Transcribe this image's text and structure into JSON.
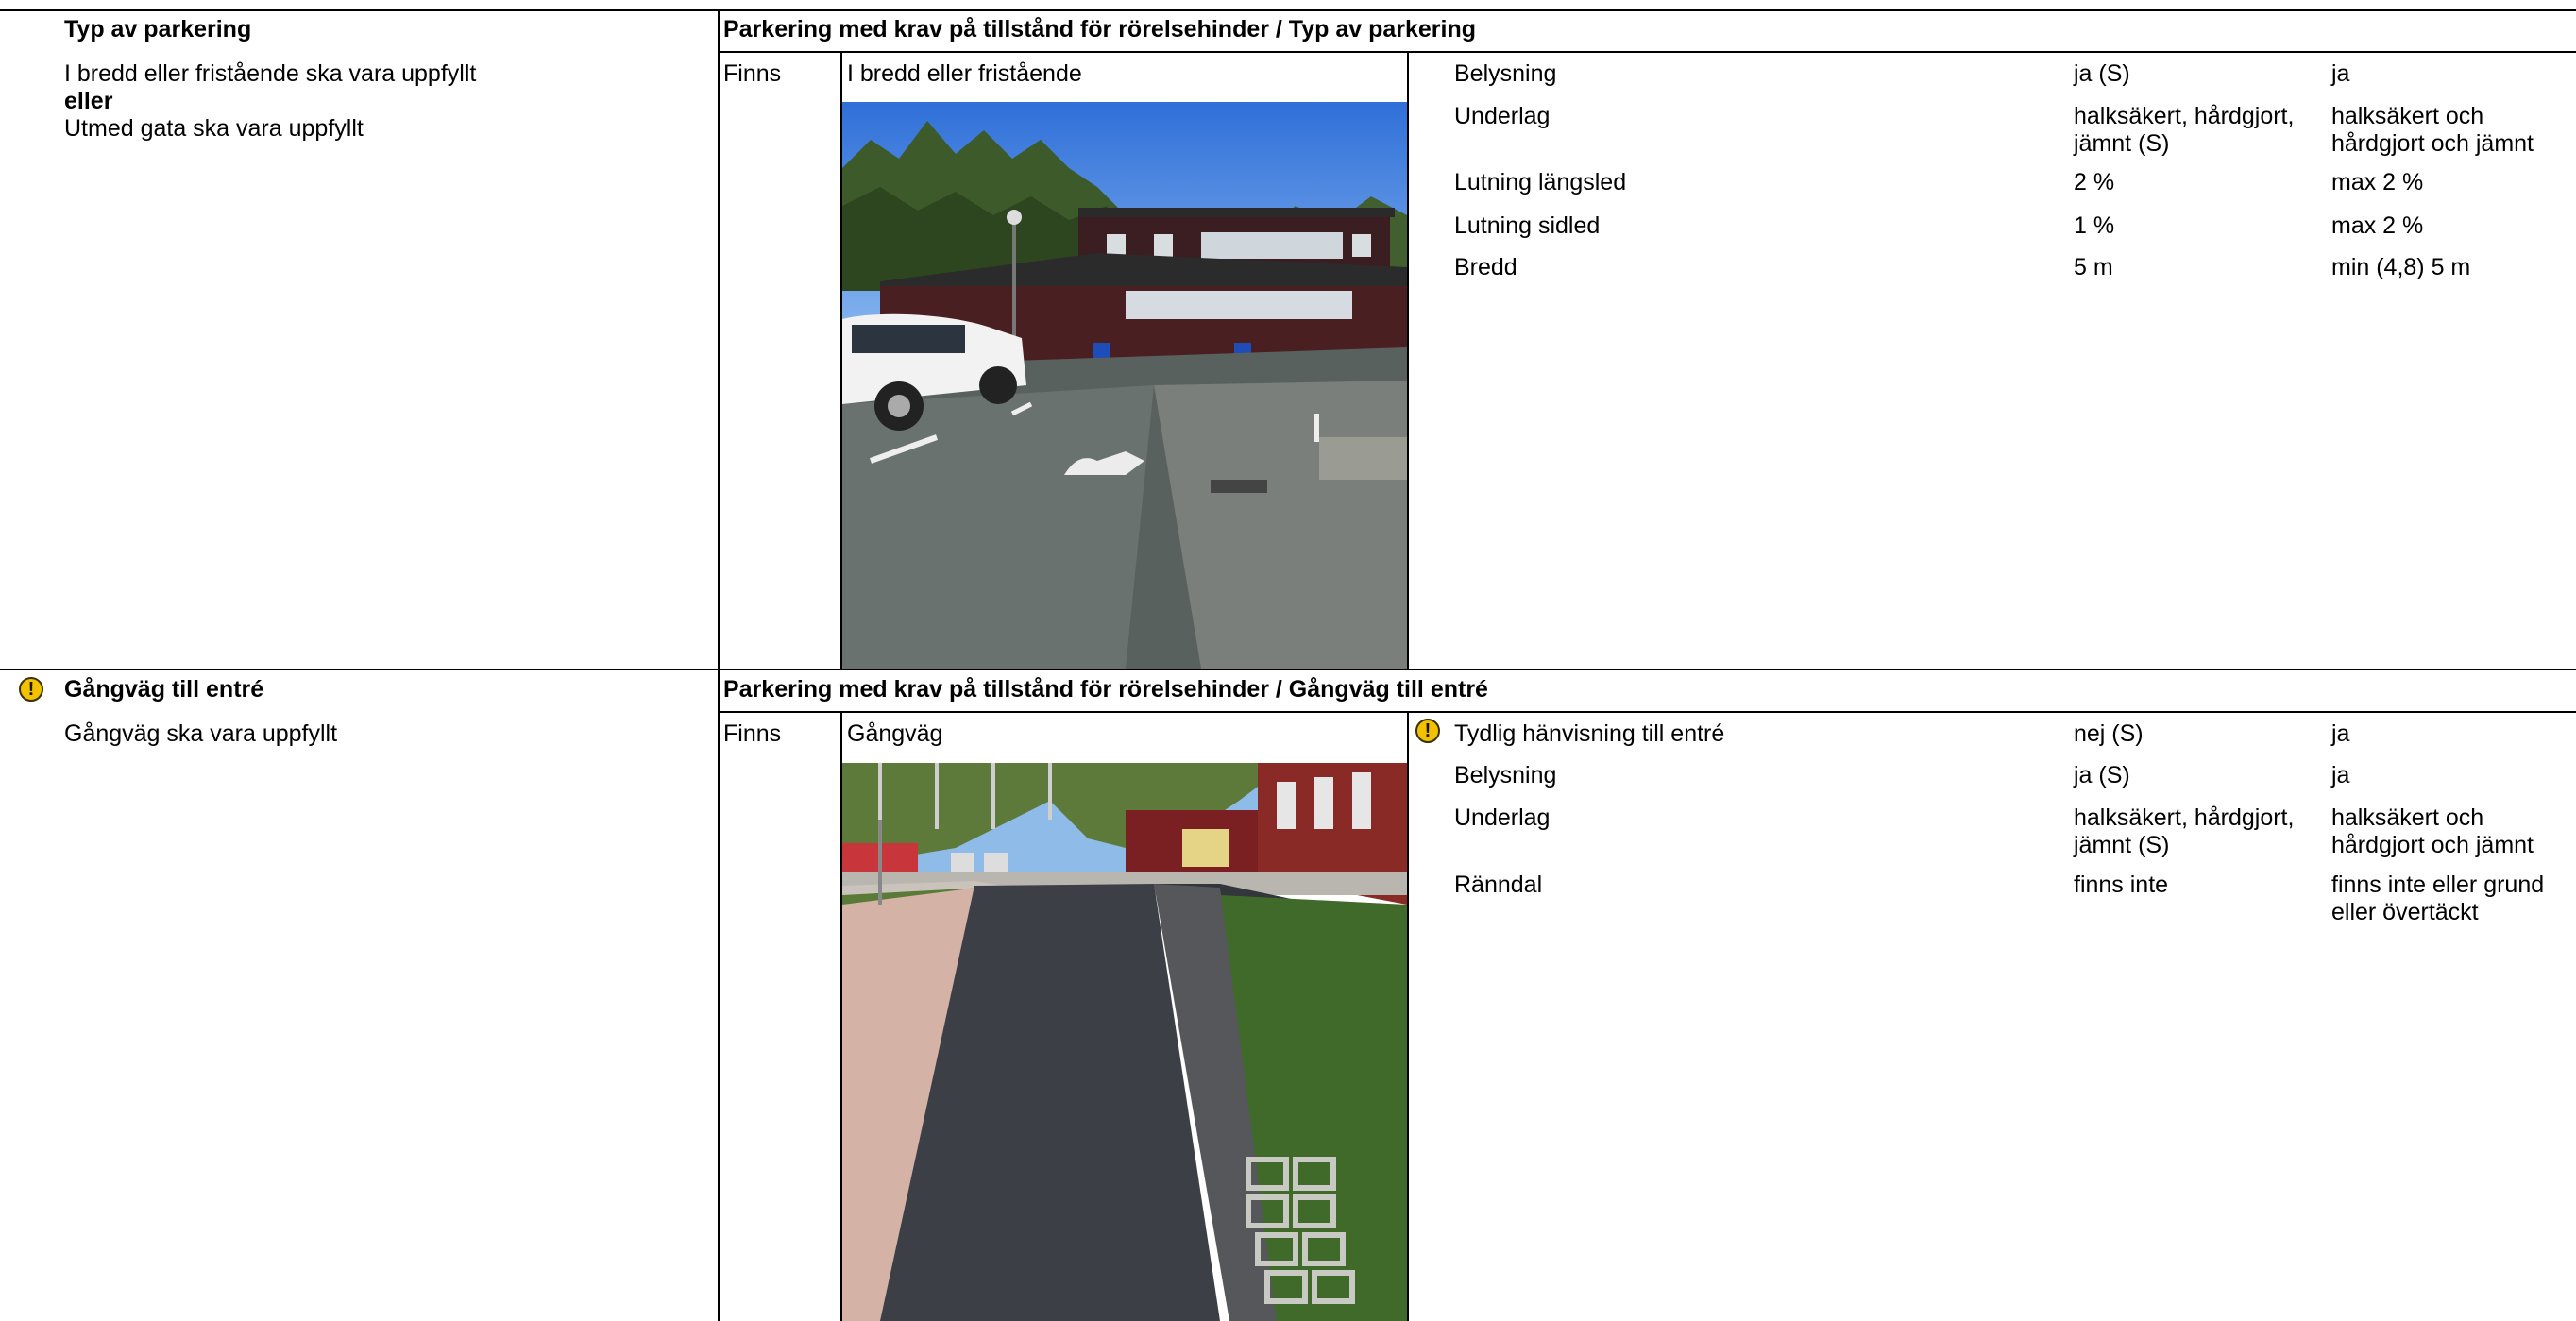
{
  "sections": [
    {
      "left_title": "Typ av parkering",
      "left_lines": [
        "I bredd eller fristående ska vara uppfyllt",
        "eller",
        "Utmed gata ska vara uppfyllt"
      ],
      "header": "Parkering med krav på tillstånd för rörelsehinder / Typ av parkering",
      "status": "Finns",
      "item_label": "I bredd eller fristående",
      "photo_icon": "parking-photo",
      "rows": [
        {
          "label": "Belysning",
          "value": "ja (S)",
          "requirement": "ja",
          "warning": false
        },
        {
          "label": "Underlag",
          "value": "halksäkert, hårdgjort, jämnt (S)",
          "value_lines": [
            "halksäkert, hårdgjort,",
            "jämnt (S)"
          ],
          "requirement": "halksäkert och hårdgjort och jämnt",
          "requirement_lines": [
            "halksäkert och",
            "hårdgjort och jämnt"
          ],
          "warning": false
        },
        {
          "label": "Lutning längsled",
          "value": "2 %",
          "requirement": "max 2 %",
          "warning": false
        },
        {
          "label": "Lutning sidled",
          "value": "1 %",
          "requirement": "max 2 %",
          "warning": false
        },
        {
          "label": "Bredd",
          "value": "5 m",
          "requirement": "min (4,8) 5 m",
          "warning": false
        }
      ]
    },
    {
      "left_title": "Gångväg till entré",
      "left_warning": true,
      "left_lines": [
        "Gångväg ska vara uppfyllt"
      ],
      "header": "Parkering med krav på tillstånd för rörelsehinder / Gångväg till entré",
      "status": "Finns",
      "item_label": "Gångväg",
      "photo_icon": "walkway-photo",
      "rows": [
        {
          "label": "Tydlig hänvisning till entré",
          "value": "nej (S)",
          "requirement": "ja",
          "warning": true
        },
        {
          "label": "Belysning",
          "value": "ja (S)",
          "requirement": "ja",
          "warning": false
        },
        {
          "label": "Underlag",
          "value": "halksäkert, hårdgjort, jämnt (S)",
          "value_lines": [
            "halksäkert, hårdgjort,",
            "jämnt (S)"
          ],
          "requirement": "halksäkert och hårdgjort och jämnt",
          "requirement_lines": [
            "halksäkert och",
            "hårdgjort och jämnt"
          ],
          "warning": false
        },
        {
          "label": "Ränndal",
          "value": "finns inte",
          "requirement": "finns inte eller grund eller övertäckt",
          "requirement_lines": [
            "finns inte eller grund",
            "eller övertäckt"
          ],
          "warning": false
        }
      ]
    }
  ],
  "colors": {
    "warning": "#f2c200",
    "rule": "#000000"
  }
}
